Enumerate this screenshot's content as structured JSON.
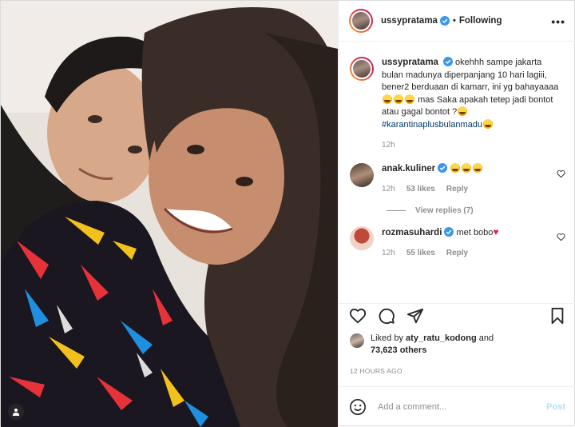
{
  "post": {
    "username": "ussypratama",
    "follow_status": "Following",
    "caption_text": "okehhh sampe jakarta bulan madunya diperpanjang 10 hari lagiii, bener2 berduaan di kamarr, ini yg bahayaaaa",
    "caption_mid": "mas Saka apakah tetep jadi bontot atau gagal bontot ?",
    "hashtag": "#karantinaplusbulanmadu",
    "caption_time": "12h"
  },
  "comments": [
    {
      "username": "anak.kuliner",
      "text": "",
      "time": "12h",
      "likes": "53 likes",
      "reply": "Reply",
      "view_replies": "View replies (7)"
    },
    {
      "username": "rozmasuhardi",
      "text": "met bobo",
      "time": "12h",
      "likes": "55 likes",
      "reply": "Reply"
    }
  ],
  "likes": {
    "prefix": "Liked by",
    "user": "aty_ratu_kodong",
    "middle": "and",
    "count_text": "73,623 others"
  },
  "time_ago": "12 HOURS AGO",
  "add_comment": {
    "placeholder": "Add a comment...",
    "post_label": "Post"
  },
  "colors": {
    "link": "#00376b",
    "muted": "#8e8e8e",
    "post_disabled": "#b2dffc",
    "heart_red": "#e0245e"
  },
  "icons": [
    "verified-icon",
    "more-icon",
    "heart-icon",
    "comment-icon",
    "share-icon",
    "bookmark-icon",
    "emoji-icon",
    "tag-icon"
  ]
}
